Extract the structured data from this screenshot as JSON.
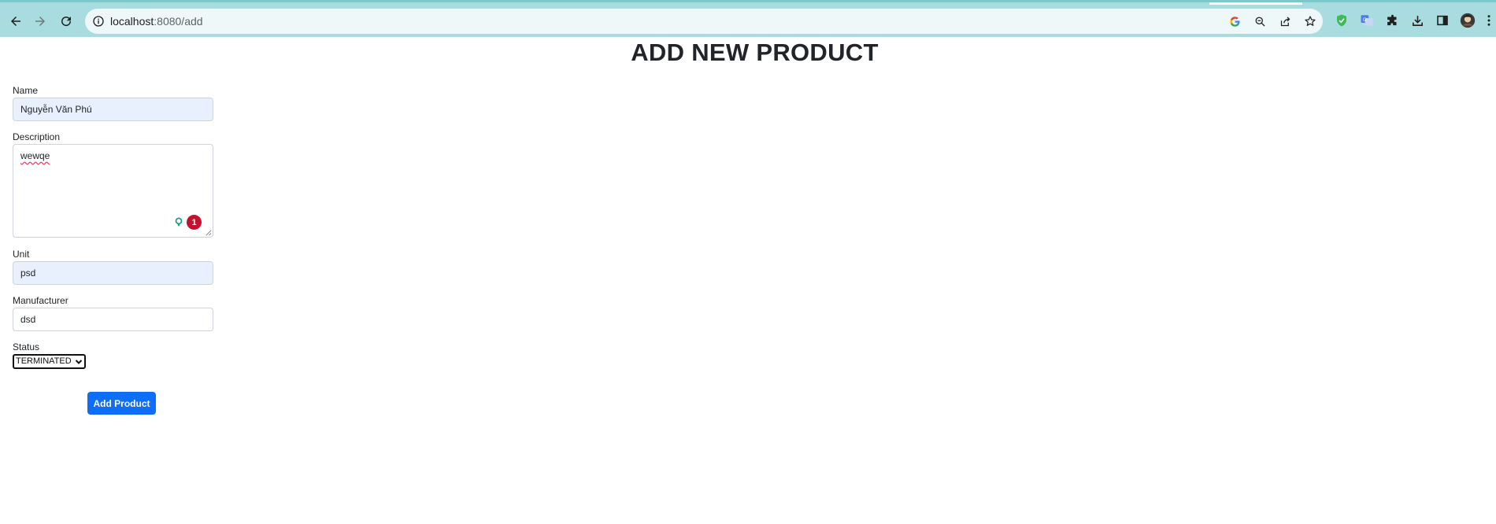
{
  "browser": {
    "url_host": "localhost",
    "url_path": ":8080/add",
    "icons": [
      "back-icon",
      "forward-icon",
      "reload-icon",
      "site-info-icon",
      "google-lens-icon",
      "zoom-icon",
      "share-icon",
      "bookmark-star-icon",
      "shield-extension-icon",
      "translate-extension-icon",
      "extensions-puzzle-icon",
      "download-icon",
      "side-panel-icon",
      "profile-avatar",
      "menu-kebab-icon"
    ]
  },
  "page": {
    "title": "ADD NEW PRODUCT"
  },
  "form": {
    "name_label": "Name",
    "name_value": "Nguyễn Văn Phú",
    "description_label": "Description",
    "description_value": "wewqe",
    "grammar_issue_count": "1",
    "unit_label": "Unit",
    "unit_value": "psd",
    "manufacturer_label": "Manufacturer",
    "manufacturer_value": "dsd",
    "status_label": "Status",
    "status_value": "TERMINATED",
    "submit_label": "Add Product"
  },
  "colors": {
    "chrome_bg": "#a9dcde",
    "primary_button": "#0d6efd",
    "autofill_bg": "#e8f0fe",
    "grammar_badge": "#c8102e"
  }
}
